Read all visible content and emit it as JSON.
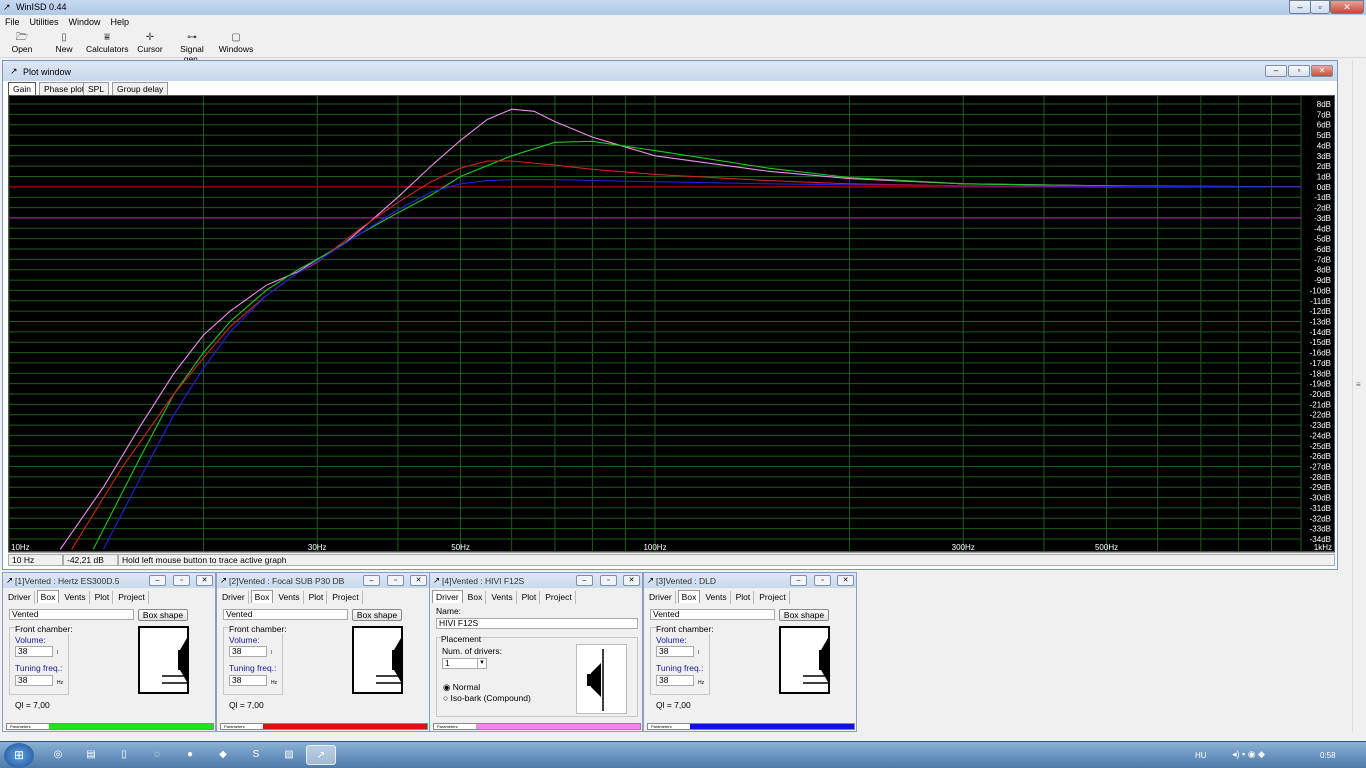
{
  "app_title": "WinISD 0.44",
  "menu": [
    "File",
    "Utilities",
    "Window",
    "Help"
  ],
  "toolbar": [
    {
      "label": "Open",
      "icon": "folder-icon",
      "glyph": "🗁"
    },
    {
      "label": "New",
      "icon": "new-project-icon",
      "glyph": "▯"
    },
    {
      "label": "Calculators",
      "icon": "calculator-icon",
      "glyph": "⩸"
    },
    {
      "label": "Cursor",
      "icon": "cursor-icon",
      "glyph": "✛"
    },
    {
      "label": "Signal gen.",
      "icon": "signal-generator-icon",
      "glyph": "⊶"
    },
    {
      "label": "Windows",
      "icon": "windows-icon",
      "glyph": "▢"
    }
  ],
  "plot_window": {
    "title": "Plot window",
    "tabs": [
      "Gain",
      "Phase plot",
      "SPL",
      "Group delay"
    ],
    "active_tab": "Gain"
  },
  "status": {
    "freq": "10 Hz",
    "value": "-42,21 dB",
    "hint": "Hold left mouse button to trace active graph"
  },
  "chart_data": {
    "type": "line",
    "xscale": "log",
    "xlim": [
      10,
      1000
    ],
    "ylim": [
      -35,
      8.5
    ],
    "x_tick_labels": [
      {
        "x": 10,
        "label": "10Hz"
      },
      {
        "x": 30,
        "label": "30Hz"
      },
      {
        "x": 50,
        "label": "50Hz"
      },
      {
        "x": 100,
        "label": "100Hz"
      },
      {
        "x": 300,
        "label": "300Hz"
      },
      {
        "x": 500,
        "label": "500Hz"
      },
      {
        "x": 1000,
        "label": "1kHz"
      }
    ],
    "y_ticks": [
      8,
      7,
      6,
      5,
      4,
      3,
      2,
      1,
      0,
      -1,
      -2,
      -3,
      -4,
      -5,
      -6,
      -7,
      -8,
      -9,
      -10,
      -11,
      -12,
      -13,
      -14,
      -15,
      -16,
      -17,
      -18,
      -19,
      -20,
      -21,
      -22,
      -23,
      -24,
      -25,
      -26,
      -27,
      -28,
      -29,
      -30,
      -31,
      -32,
      -33,
      -34
    ],
    "y_unit": "dB",
    "grid": true,
    "reference_lines": [
      {
        "y": 0,
        "color": "#c00000"
      },
      {
        "y": -3,
        "color": "#9a2ea0"
      }
    ],
    "series": [
      {
        "color": "#f08cf0",
        "x": [
          12,
          14,
          16,
          18,
          20,
          22,
          25,
          28,
          30,
          33,
          36,
          40,
          45,
          50,
          55,
          60,
          65,
          70,
          80,
          100,
          150,
          200,
          300,
          500,
          700,
          1000
        ],
        "y": [
          -35,
          -29,
          -23,
          -18,
          -14.3,
          -12,
          -9.5,
          -8.2,
          -7,
          -5.5,
          -3.5,
          -1,
          2,
          4.5,
          6.5,
          7.5,
          7.3,
          6.3,
          4.8,
          3,
          1.5,
          0.8,
          0.3,
          0.1,
          0,
          0
        ]
      },
      {
        "color": "#1ec81e",
        "x": [
          13.5,
          16,
          18,
          20,
          22,
          25,
          28,
          30,
          35,
          40,
          45,
          50,
          60,
          70,
          80,
          100,
          150,
          200,
          300,
          500,
          1000
        ],
        "y": [
          -35,
          -26,
          -20,
          -16,
          -13,
          -10,
          -8,
          -7,
          -4.5,
          -2.5,
          -0.8,
          1,
          3,
          4.3,
          4.4,
          3.5,
          1.8,
          0.9,
          0.3,
          0.1,
          0
        ]
      },
      {
        "color": "#d22020",
        "x": [
          12.5,
          15,
          18,
          20,
          22,
          25,
          28,
          30,
          35,
          40,
          45,
          50,
          55,
          60,
          70,
          80,
          100,
          150,
          200,
          300,
          500,
          1000
        ],
        "y": [
          -35,
          -27,
          -20,
          -16.5,
          -13.5,
          -10.5,
          -8.3,
          -7.3,
          -4,
          -1.5,
          0.5,
          1.8,
          2.5,
          2.5,
          2.1,
          1.7,
          1.2,
          0.6,
          0.3,
          0.1,
          0,
          0
        ]
      },
      {
        "color": "#2020e0",
        "x": [
          14,
          16,
          18,
          20,
          22,
          25,
          28,
          30,
          35,
          40,
          45,
          50,
          55,
          60,
          70,
          80,
          100,
          150,
          200,
          300,
          1000
        ],
        "y": [
          -35,
          -28,
          -22,
          -17.5,
          -14,
          -10.5,
          -8.3,
          -7.2,
          -4.5,
          -2.2,
          -0.5,
          0.3,
          0.6,
          0.7,
          0.7,
          0.6,
          0.5,
          0.3,
          0.2,
          0.1,
          0
        ]
      }
    ]
  },
  "panels": [
    {
      "title": "[1]Vented : Hertz ES300D.5",
      "tabs": [
        "Driver",
        "Box",
        "Vents",
        "Plot",
        "Project"
      ],
      "active": "Box",
      "box_type": "Vented",
      "box_shape": "Box shape",
      "front_chamber": "Front chamber:",
      "volume_label": "Volume:",
      "volume": "38",
      "volume_unit": "l",
      "tuning_label": "Tuning freq.:",
      "tuning": "38",
      "tuning_unit": "Hz",
      "ql": "Ql = 7,00",
      "param_label": "Parameters",
      "color": "#22e022"
    },
    {
      "title": "[2]Vented : Focal SUB P30 DB",
      "tabs": [
        "Driver",
        "Box",
        "Vents",
        "Plot",
        "Project"
      ],
      "active": "Box",
      "box_type": "Vented",
      "box_shape": "Box shape",
      "front_chamber": "Front chamber:",
      "volume_label": "Volume:",
      "volume": "38",
      "volume_unit": "l",
      "tuning_label": "Tuning freq.:",
      "tuning": "38",
      "tuning_unit": "Hz",
      "ql": "Ql = 7,00",
      "param_label": "Parameters",
      "color": "#e01010"
    },
    {
      "title": "[4]Vented : HIVI F12S",
      "tabs": [
        "Driver",
        "Box",
        "Vents",
        "Plot",
        "Project"
      ],
      "active": "Driver",
      "name_label": "Name:",
      "name": "HIVI F12S",
      "placement": "Placement",
      "num_drivers_label": "Num. of drivers:",
      "num_drivers": "1",
      "radio_normal": "Normal",
      "radio_iso": "Iso-bark (Compound)",
      "param_label": "Parameters",
      "color": "#ee88ee"
    },
    {
      "title": "[3]Vented : DLD",
      "tabs": [
        "Driver",
        "Box",
        "Vents",
        "Plot",
        "Project"
      ],
      "active": "Box",
      "box_type": "Vented",
      "box_shape": "Box shape",
      "front_chamber": "Front chamber:",
      "volume_label": "Volume:",
      "volume": "38",
      "volume_unit": "l",
      "tuning_label": "Tuning freq.:",
      "tuning": "38",
      "tuning_unit": "Hz",
      "ql": "Ql = 7,00",
      "param_label": "Parameters",
      "color": "#1010e0"
    }
  ],
  "taskbar": {
    "lang": "HU",
    "clock": "0:58"
  }
}
